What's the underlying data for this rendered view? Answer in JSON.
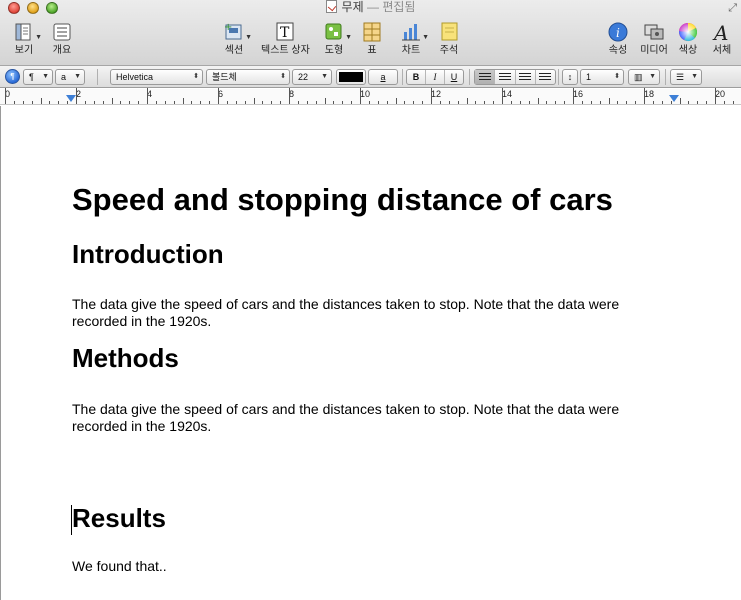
{
  "window": {
    "title": "무제",
    "separator": " — ",
    "status": "편집됨"
  },
  "toolbar": {
    "view": "보기",
    "overview": "개요",
    "section": "섹션",
    "textbox": "텍스트 상자",
    "shape": "도형",
    "table": "표",
    "chart": "차트",
    "comment": "주석",
    "inspector": "속성",
    "media": "미디어",
    "colors": "색상",
    "fonts": "서체"
  },
  "formatbar": {
    "paragraph_style": "¶",
    "char_style": "a",
    "font_family": "Helvetica",
    "font_style": "볼드체",
    "font_size": "22",
    "highlight_glyph": "a",
    "bold": "B",
    "italic": "I",
    "underline": "U",
    "line_spacing": "1",
    "text_color": "#000000"
  },
  "ruler": {
    "labels": [
      "0",
      "2",
      "4",
      "6",
      "8",
      "10",
      "12",
      "14",
      "16",
      "18",
      "20"
    ]
  },
  "document": {
    "title": "Speed and stopping distance of cars",
    "sections": [
      {
        "heading": "Introduction",
        "body": "The data give the speed of cars and the distances taken to stop. Note that the data were recorded in the 1920s."
      },
      {
        "heading": "Methods",
        "body": "The data give the speed of cars and the distances taken to stop. Note that the data were recorded in the 1920s."
      },
      {
        "heading": "Results",
        "body": "We found that.."
      }
    ]
  }
}
